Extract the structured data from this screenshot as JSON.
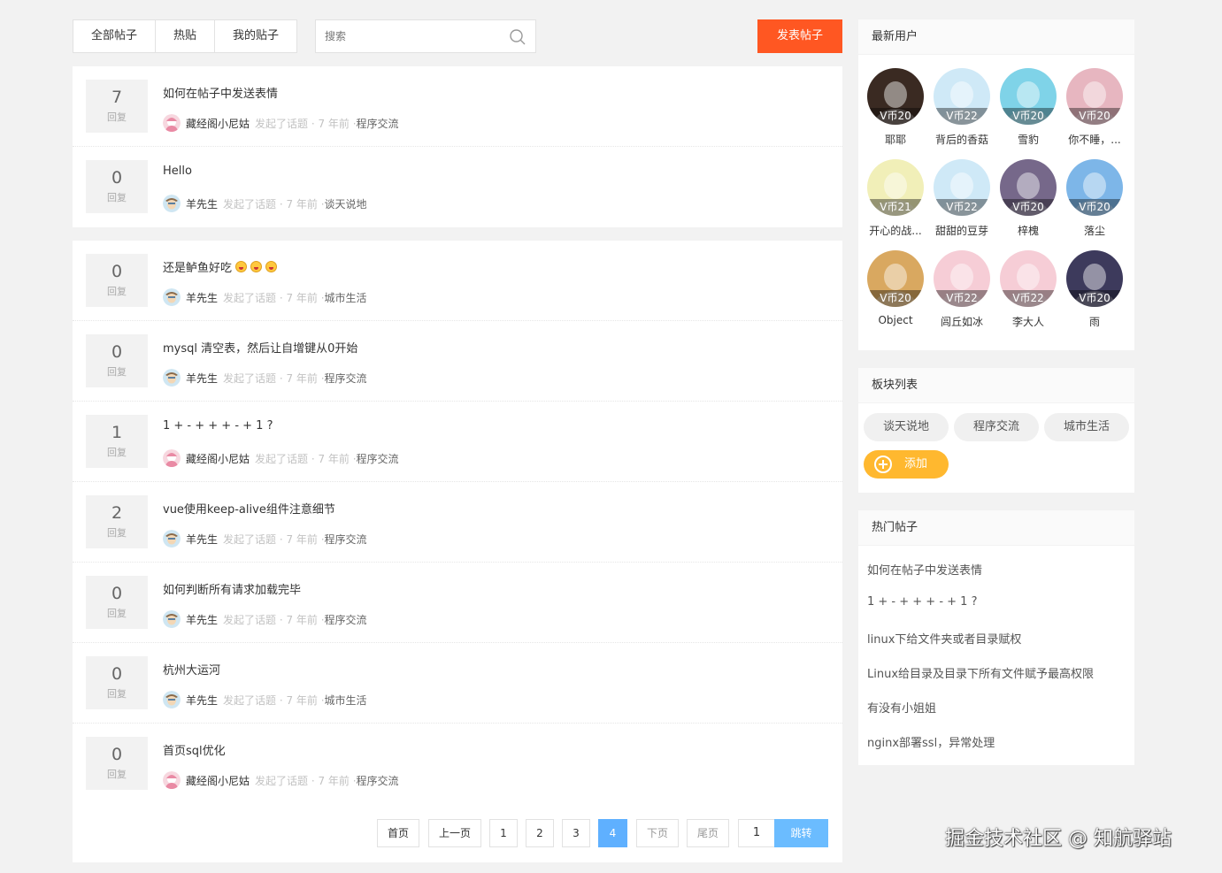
{
  "toolbar": {
    "tabs": [
      "全部帖子",
      "热贴",
      "我的贴子"
    ],
    "search_placeholder": "搜索",
    "post_button": "发表帖子"
  },
  "posts_top": [
    {
      "replies": "7",
      "reply_label": "回复",
      "title": "如何在帖子中发送表情",
      "author": "藏经阁小尼姑",
      "action": "发起了话题 · 7 年前 · ",
      "category": "程序交流",
      "avatar": "girl"
    },
    {
      "replies": "0",
      "reply_label": "回复",
      "title": "Hello",
      "author": "羊先生",
      "action": "发起了话题 · 7 年前 · ",
      "category": "谈天说地",
      "avatar": "goat"
    }
  ],
  "posts": [
    {
      "replies": "0",
      "reply_label": "回复",
      "title": "还是鲈鱼好吃",
      "emojis": 3,
      "author": "羊先生",
      "action": "发起了话题 · 7 年前 · ",
      "category": "城市生活",
      "avatar": "goat"
    },
    {
      "replies": "0",
      "reply_label": "回复",
      "title": "mysql 清空表，然后让自增键从0开始",
      "author": "羊先生",
      "action": "发起了话题 · 7 年前 · ",
      "category": "程序交流",
      "avatar": "goat"
    },
    {
      "replies": "1",
      "reply_label": "回复",
      "title": "1 + - + + + - + 1 ?",
      "author": "藏经阁小尼姑",
      "action": "发起了话题 · 7 年前 · ",
      "category": "程序交流",
      "avatar": "girl"
    },
    {
      "replies": "2",
      "reply_label": "回复",
      "title": "vue使用keep-alive组件注意细节",
      "author": "羊先生",
      "action": "发起了话题 · 7 年前 · ",
      "category": "程序交流",
      "avatar": "goat"
    },
    {
      "replies": "0",
      "reply_label": "回复",
      "title": "如何判断所有请求加载完毕",
      "author": "羊先生",
      "action": "发起了话题 · 7 年前 · ",
      "category": "程序交流",
      "avatar": "goat"
    },
    {
      "replies": "0",
      "reply_label": "回复",
      "title": "杭州大运河",
      "author": "羊先生",
      "action": "发起了话题 · 7 年前 · ",
      "category": "城市生活",
      "avatar": "goat"
    },
    {
      "replies": "0",
      "reply_label": "回复",
      "title": "首页sql优化",
      "author": "藏经阁小尼姑",
      "action": "发起了话题 · 7 年前 · ",
      "category": "程序交流",
      "avatar": "girl"
    }
  ],
  "pagination": {
    "first": "首页",
    "prev": "上一页",
    "pages": [
      "1",
      "2",
      "3",
      "4"
    ],
    "current": "4",
    "next": "下页",
    "last": "尾页",
    "jump_value": "1",
    "jump": "跳转"
  },
  "users_panel": {
    "title": "最新用户",
    "users": [
      {
        "name": "耶耶",
        "coin": "V币20",
        "color": "#3a2a22"
      },
      {
        "name": "背后的香菇",
        "coin": "V币22",
        "color": "#cfe9f7"
      },
      {
        "name": "雪豹",
        "coin": "V币20",
        "color": "#7fd3e8"
      },
      {
        "name": "你不睡，...",
        "coin": "V币20",
        "color": "#e7b6c0"
      },
      {
        "name": "开心的战...",
        "coin": "V币21",
        "color": "#f1efb8"
      },
      {
        "name": "甜甜的豆芽",
        "coin": "V币22",
        "color": "#cfe9f7"
      },
      {
        "name": "梓槐",
        "coin": "V币20",
        "color": "#76688a"
      },
      {
        "name": "落尘",
        "coin": "V币20",
        "color": "#7db6e8"
      },
      {
        "name": "Object",
        "coin": "V币20",
        "color": "#d9a860"
      },
      {
        "name": "闾丘如冰",
        "coin": "V币22",
        "color": "#f6cdd6"
      },
      {
        "name": "李大人",
        "coin": "V币22",
        "color": "#f6cdd6"
      },
      {
        "name": "雨",
        "coin": "V币20",
        "color": "#3d3a5c"
      }
    ]
  },
  "categories_panel": {
    "title": "板块列表",
    "items": [
      "谈天说地",
      "程序交流",
      "城市生活"
    ],
    "add_label": "添加"
  },
  "hot_panel": {
    "title": "热门帖子",
    "items": [
      "如何在帖子中发送表情",
      "1 + - + + + - + 1 ?",
      "linux下给文件夹或者目录赋权",
      "Linux给目录及目录下所有文件赋予最高权限",
      "有没有小姐姐",
      "nginx部署ssl，异常处理"
    ]
  },
  "watermark": "掘金技术社区 @ 知航驿站",
  "colors": {
    "accent_orange": "#ff5722",
    "accent_blue": "#5fb0ff",
    "add_yellow": "#ffb82f"
  }
}
